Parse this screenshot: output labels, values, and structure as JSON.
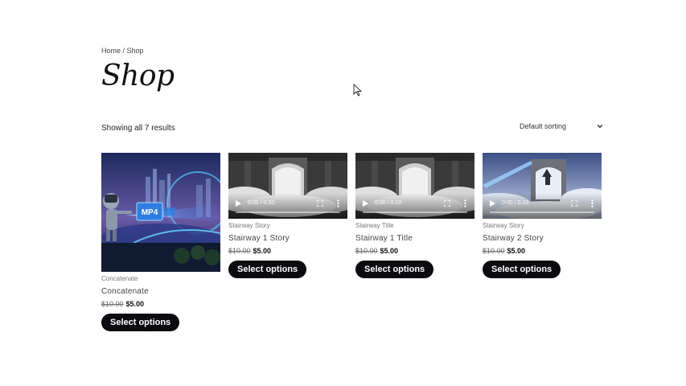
{
  "breadcrumb": {
    "home": "Home",
    "separator": " / ",
    "current": "Shop"
  },
  "page": {
    "title": "Shop"
  },
  "toolbar": {
    "results": "Showing all 7 results",
    "sort_label": "Default sorting",
    "sort_icon": "chevron-down-icon"
  },
  "products": [
    {
      "category": "Concatenate",
      "name": "Concatenate",
      "price_old": "$10.00",
      "price_new": "$5.00",
      "button": "Select options",
      "image_text": "MP4"
    },
    {
      "category": "Stairway Story",
      "name": "Stairway 1 Story",
      "price_old": "$10.00",
      "price_new": "$5.00",
      "button": "Select options",
      "video_time": "0:00 / 0:10"
    },
    {
      "category": "Stairway Title",
      "name": "Stairway 1 Title",
      "price_old": "$10.00",
      "price_new": "$5.00",
      "button": "Select options",
      "video_time": "0:00 / 0:10"
    },
    {
      "category": "Stairway Story",
      "name": "Stairway 2 Story",
      "price_old": "$10.00",
      "price_new": "$5.00",
      "button": "Select options",
      "video_time": "0:00 / 0:10"
    }
  ],
  "colors": {
    "button_bg": "#0b0b10",
    "button_text": "#ffffff",
    "image_accent": "#3aa7ff"
  }
}
